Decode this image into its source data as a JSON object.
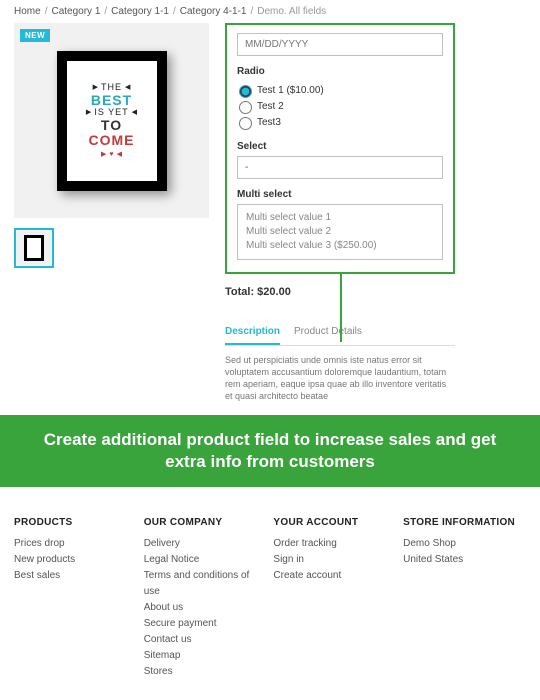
{
  "breadcrumb": {
    "items": [
      "Home",
      "Category 1",
      "Category 1-1",
      "Category 4-1-1"
    ],
    "last": "Demo. All fields"
  },
  "badge": "NEW",
  "poster": {
    "line1": "THE",
    "line2": "BEST",
    "line3": "IS YET",
    "line4": "TO",
    "line5": "COME"
  },
  "form": {
    "date_placeholder": "MM/DD/YYYY",
    "radio_label": "Radio",
    "radio_items": [
      {
        "label": "Test 1 ($10.00)"
      },
      {
        "label": "Test 2"
      },
      {
        "label": "Test3"
      }
    ],
    "radio_checked_index": 0,
    "select_label": "Select",
    "select_value": "-",
    "multi_label": "Multi select",
    "multi_options": [
      "Multi select value 1",
      "Multi select value 2",
      "Multi select value 3 ($250.00)"
    ]
  },
  "total_label": "Total: $20.00",
  "tabs": {
    "items": [
      "Description",
      "Product Details"
    ],
    "active_index": 0
  },
  "description_text": "Sed ut perspiciatis unde omnis iste natus error sit voluptatem accusantium doloremque laudantium, totam rem aperiam, eaque ipsa quae ab illo inventore veritatis et quasi architecto beatae",
  "banner": "Create additional product field to increase sales and get extra info from customers",
  "footer": {
    "col1": {
      "title": "PRODUCTS",
      "links": [
        "Prices drop",
        "New products",
        "Best sales"
      ]
    },
    "col2": {
      "title": "OUR COMPANY",
      "links": [
        "Delivery",
        "Legal Notice",
        "Terms and conditions of use",
        "About us",
        "Secure payment",
        "Contact us",
        "Sitemap",
        "Stores"
      ]
    },
    "col3": {
      "title": "YOUR ACCOUNT",
      "links": [
        "Order tracking",
        "Sign in",
        "Create account"
      ]
    },
    "col4": {
      "title": "STORE INFORMATION",
      "lines": [
        "Demo Shop",
        "United States"
      ]
    }
  }
}
